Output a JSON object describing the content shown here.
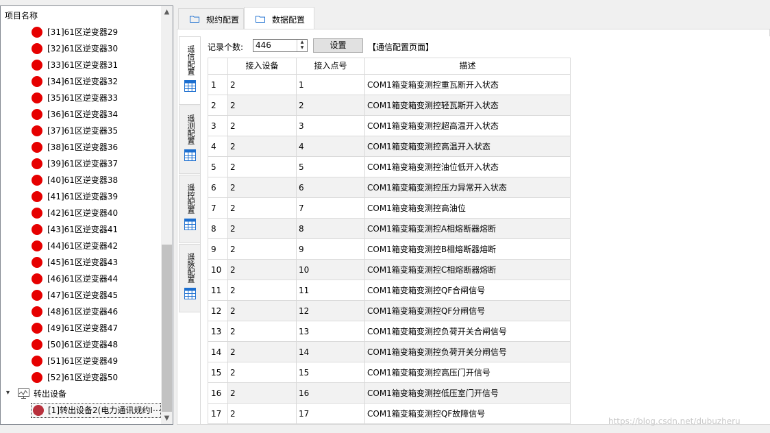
{
  "tree": {
    "header": "项目名称",
    "items": [
      "[31]61区逆变器29",
      "[32]61区逆变器30",
      "[33]61区逆变器31",
      "[34]61区逆变器32",
      "[35]61区逆变器33",
      "[36]61区逆变器34",
      "[37]61区逆变器35",
      "[38]61区逆变器36",
      "[39]61区逆变器37",
      "[40]61区逆变器38",
      "[41]61区逆变器39",
      "[42]61区逆变器40",
      "[43]61区逆变器41",
      "[44]61区逆变器42",
      "[45]61区逆变器43",
      "[46]61区逆变器44",
      "[47]61区逆变器45",
      "[48]61区逆变器46",
      "[49]61区逆变器47",
      "[50]61区逆变器48",
      "[51]61区逆变器49",
      "[52]61区逆变器50"
    ],
    "group": "转出设备",
    "selected": "[1]转出设备2(电力通讯规约I⋯",
    "icons": {
      "chevron": "▾",
      "up": "▲",
      "down": "▼"
    }
  },
  "tabs": [
    "规约配置",
    "数据配置"
  ],
  "active_tab": 1,
  "vtabs": [
    "遥信配置",
    "遥测配置",
    "遥控配置",
    "遥脉配置"
  ],
  "toolbar": {
    "record_label": "记录个数:",
    "record_count": "446",
    "set_label": "设置",
    "page_tag": "【通信配置页面】"
  },
  "table": {
    "headers": [
      "接入设备",
      "接入点号",
      "描述"
    ],
    "rows": [
      [
        "1",
        "2",
        "1",
        "COM1箱变箱变测控重瓦斯开入状态"
      ],
      [
        "2",
        "2",
        "2",
        "COM1箱变箱变测控轻瓦斯开入状态"
      ],
      [
        "3",
        "2",
        "3",
        "COM1箱变箱变测控超高温开入状态"
      ],
      [
        "4",
        "2",
        "4",
        "COM1箱变箱变测控高温开入状态"
      ],
      [
        "5",
        "2",
        "5",
        "COM1箱变箱变测控油位低开入状态"
      ],
      [
        "6",
        "2",
        "6",
        "COM1箱变箱变测控压力异常开入状态"
      ],
      [
        "7",
        "2",
        "7",
        "COM1箱变箱变测控高油位"
      ],
      [
        "8",
        "2",
        "8",
        "COM1箱变箱变测控A相熔断器熔断"
      ],
      [
        "9",
        "2",
        "9",
        "COM1箱变箱变测控B相熔断器熔断"
      ],
      [
        "10",
        "2",
        "10",
        "COM1箱变箱变测控C相熔断器熔断"
      ],
      [
        "11",
        "2",
        "11",
        "COM1箱变箱变测控QF合闸信号"
      ],
      [
        "12",
        "2",
        "12",
        "COM1箱变箱变测控QF分闸信号"
      ],
      [
        "13",
        "2",
        "13",
        "COM1箱变箱变测控负荷开关合闸信号"
      ],
      [
        "14",
        "2",
        "14",
        "COM1箱变箱变测控负荷开关分闸信号"
      ],
      [
        "15",
        "2",
        "15",
        "COM1箱变箱变测控高压门开信号"
      ],
      [
        "16",
        "2",
        "16",
        "COM1箱变箱变测控低压室门开信号"
      ],
      [
        "17",
        "2",
        "17",
        "COM1箱变箱变测控QF故障信号"
      ]
    ]
  },
  "watermark": "https://blog.csdn.net/dubuzheru",
  "colors": {
    "status_red": "#e60000",
    "selected_dot": "#b8303c",
    "icon_blue": "#1c6fd0"
  }
}
